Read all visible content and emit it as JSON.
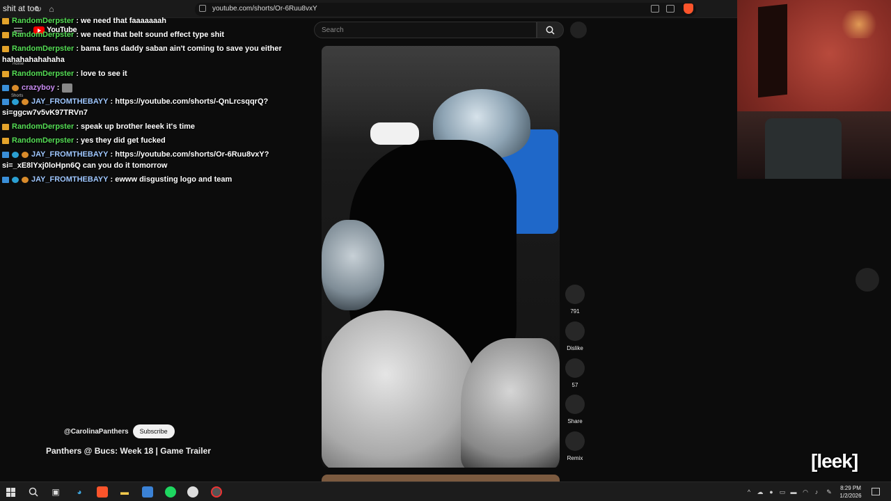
{
  "browser": {
    "tab_title": "shit at too",
    "url": "youtube.com/shorts/Or-6Ruu8vxY"
  },
  "youtube": {
    "logo_text": "YouTube",
    "sidebar_labels": [
      "Home",
      "Shorts"
    ],
    "search_placeholder": "Search"
  },
  "chat": {
    "messages": [
      {
        "user": "RandomDerpster",
        "text": ": we need that faaaaaaah"
      },
      {
        "user": "RandomDerpster",
        "text": ": we need that belt sound effect type shit"
      },
      {
        "user": "RandomDerpster",
        "text": ": bama fans daddy saban ain't coming to save you either hahahahahahaha"
      },
      {
        "user": "RandomDerpster",
        "text": ": love to see it"
      },
      {
        "user": "crazyboy",
        "text": ":"
      },
      {
        "user": "JAY_FROMTHEBAYY",
        "text": ": https://youtube.com/shorts/-QnLrcsqqrQ?si=ggcw7v5vK97TRVn7"
      },
      {
        "user": "RandomDerpster",
        "text": ": speak up brother leeek it's time"
      },
      {
        "user": "RandomDerpster",
        "text": ": yes they did get fucked"
      },
      {
        "user": "JAY_FROMTHEBAYY",
        "text": ": https://youtube.com/shorts/Or-6Ruu8vxY?si=_xE8lYxj0loHpn6Q can you do it tomorrow"
      },
      {
        "user": "JAY_FROMTHEBAYY",
        "text": ": ewww disgusting logo and team"
      }
    ]
  },
  "short": {
    "channel": "@CarolinaPanthers",
    "subscribe_label": "Subscribe",
    "title": "Panthers @ Bucs: Week 18 | Game Trailer",
    "actions": {
      "like_count": "791",
      "dislike_label": "Dislike",
      "comment_count": "57",
      "share_label": "Share",
      "remix_label": "Remix"
    }
  },
  "overlay": {
    "streamer_tag": "[leek]"
  },
  "taskbar": {
    "time": "8:29 PM",
    "date": "1/2/2026"
  },
  "colors": {
    "accent_red": "#ff0000",
    "chat_green": "#55dd55",
    "chat_purple": "#c98cf2",
    "chat_blue": "#9fc7ff"
  }
}
